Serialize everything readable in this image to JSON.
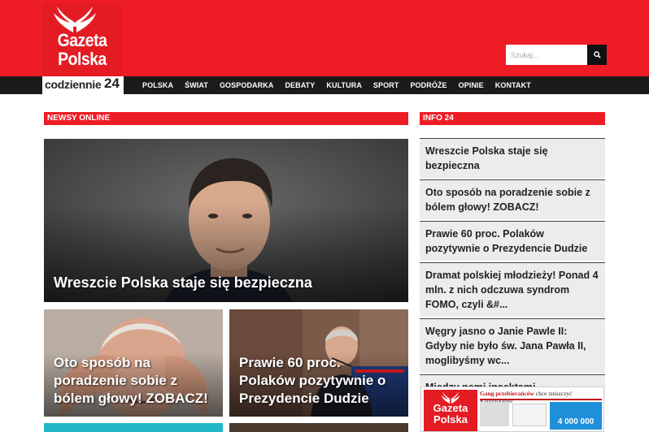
{
  "header": {
    "logo_line1": "Gazeta",
    "logo_line2": "Polska",
    "logo_sub": "codziennie",
    "logo_sub_num": "24",
    "search_placeholder": "Szukaj...",
    "nav": [
      "POLSKA",
      "ŚWIAT",
      "GOSPODARKA",
      "DEBATY",
      "KULTURA",
      "SPORT",
      "PODRÓŻE",
      "OPINIE",
      "KONTAKT"
    ]
  },
  "sections": {
    "newsy_online": "NEWSY ONLINE",
    "info24": "INFO 24"
  },
  "cards": {
    "main": "Wreszcie Polska staje się bezpieczna",
    "card2": "Oto sposób na poradzenie sobie z bólem głowy! ZOBACZ!",
    "card3": "Prawie 60 proc. Polaków pozytywnie o Prezydencie Dudzie"
  },
  "info_list": [
    "Wreszcie Polska staje się bezpieczna",
    "Oto sposób na poradzenie sobie z bólem głowy! ZOBACZ!",
    "Prawie 60 proc. Polaków pozytywnie o Prezydencie Dudzie",
    "Dramat polskiej młodzieży! Ponad 4 mln. z nich odczuwa syndrom FOMO, czyli &#...",
    "Węgry jasno o Janie Pawle II: Gdyby nie było św. Jana Pawła II, moglibyśmy wc...",
    "Między nami insektami"
  ],
  "ad": {
    "logo_line1": "Gazeta",
    "logo_line2": "Polska",
    "headline_red": "Gang przebierańców",
    "headline_rest": "chce zniszczyć Kamińskiego",
    "number": "4 000 000"
  },
  "colors": {
    "brand_red": "#ee1c25",
    "nav_dark": "#1b1b1b",
    "list_bg": "#ececec"
  }
}
